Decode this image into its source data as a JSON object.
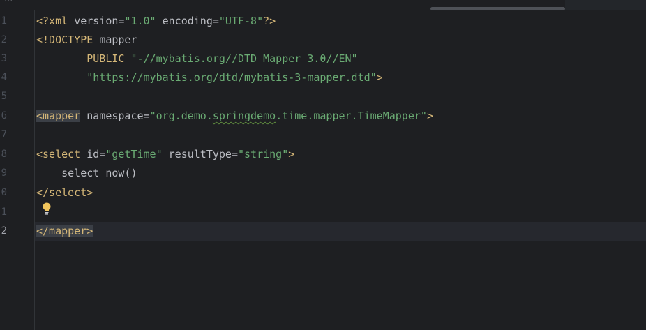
{
  "window": {
    "topbar_text": "..."
  },
  "gutter": {
    "line_numbers": [
      "1",
      "2",
      "3",
      "4",
      "5",
      "6",
      "7",
      "8",
      "9",
      "0",
      "1",
      "2"
    ]
  },
  "code": {
    "l1": {
      "t1": "<?xml ",
      "a1": "version",
      "e1": "=",
      "s1": "\"1.0\"",
      "sp": " ",
      "a2": "encoding",
      "e2": "=",
      "s2": "\"UTF-8\"",
      "t2": "?>"
    },
    "l2": {
      "t1": "<!DOCTYPE ",
      "x1": "mapper"
    },
    "l3": {
      "ind": "        ",
      "t1": "PUBLIC ",
      "s1": "\"-//mybatis.org//DTD Mapper 3.0//EN\""
    },
    "l4": {
      "ind": "        ",
      "s1": "\"https://mybatis.org/dtd/mybatis-3-mapper.dtd\"",
      "t1": ">"
    },
    "l6": {
      "tag": "<mapper",
      "sp": " ",
      "a1": "namespace",
      "e1": "=",
      "s1a": "\"org.demo.",
      "s1b": "springdemo",
      "s1c": ".time.mapper.TimeMapper\"",
      "t1": ">"
    },
    "l8": {
      "tag": "<select",
      "sp1": " ",
      "a1": "id",
      "e1": "=",
      "s1": "\"getTime\"",
      "sp2": " ",
      "a2": "resultType",
      "e2": "=",
      "s2": "\"string\"",
      "t1": ">"
    },
    "l9": {
      "ind": "    ",
      "txt": "select now()"
    },
    "l10": {
      "tag": "</select>"
    },
    "l12": {
      "tag": "</mapper>"
    }
  },
  "icons": {
    "intention": "lightbulb-icon"
  },
  "colors": {
    "background": "#1e1f22",
    "tag": "#d5b778",
    "string": "#6aab73",
    "text": "#bcbec4",
    "line_number": "#4b5059",
    "bulb": "#f2c55c"
  }
}
